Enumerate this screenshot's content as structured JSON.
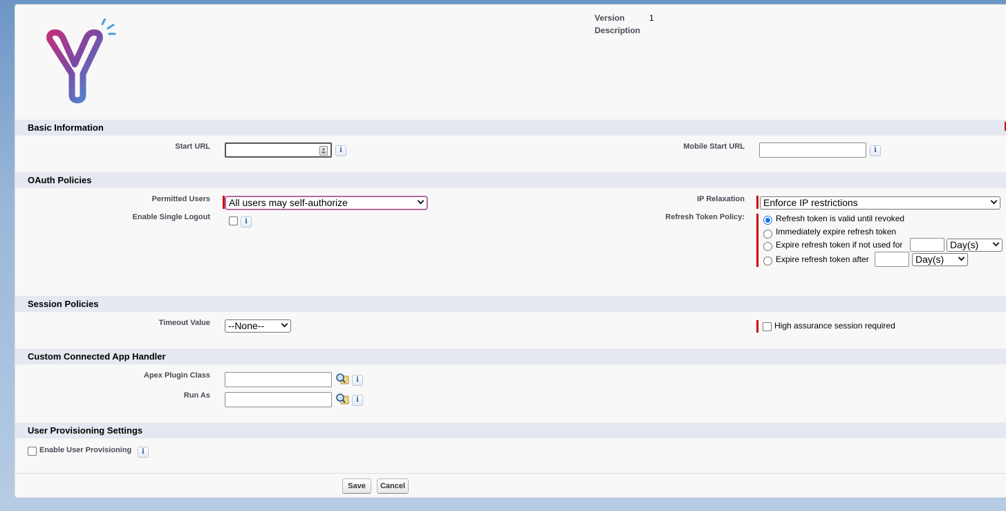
{
  "header": {
    "version_label": "Version",
    "version_value": "1",
    "description_label": "Description"
  },
  "sections": {
    "basic": "Basic Information",
    "oauth": "OAuth Policies",
    "session": "Session Policies",
    "handler": "Custom Connected App Handler",
    "provisioning": "User Provisioning Settings"
  },
  "basic": {
    "start_url_label": "Start URL",
    "start_url_value": "",
    "mobile_start_url_label": "Mobile Start URL",
    "mobile_start_url_value": ""
  },
  "oauth": {
    "permitted_users_label": "Permitted Users",
    "permitted_users_value": "All users may self-authorize",
    "enable_single_logout_label": "Enable Single Logout",
    "ip_relaxation_label": "IP Relaxation",
    "ip_relaxation_value": "Enforce IP restrictions",
    "refresh_token_policy_label": "Refresh Token Policy:",
    "refresh_options": [
      "Refresh token is valid until revoked",
      "Immediately expire refresh token",
      "Expire refresh token if not used for",
      "Expire refresh token after"
    ],
    "selected_refresh_option": 0,
    "unit_value": "Day(s)"
  },
  "session": {
    "timeout_label": "Timeout Value",
    "timeout_value": "--None--",
    "high_assurance_label": "High assurance session required"
  },
  "handler": {
    "apex_plugin_label": "Apex Plugin Class",
    "run_as_label": "Run As"
  },
  "provisioning": {
    "enable_label": "Enable User Provisioning"
  },
  "buttons": {
    "save": "Save",
    "cancel": "Cancel"
  },
  "colors": {
    "required": "#cc0000",
    "section_bg": "#e5e8f0",
    "radio_selected": "#1a73e8"
  },
  "icons": {
    "info": "i"
  }
}
